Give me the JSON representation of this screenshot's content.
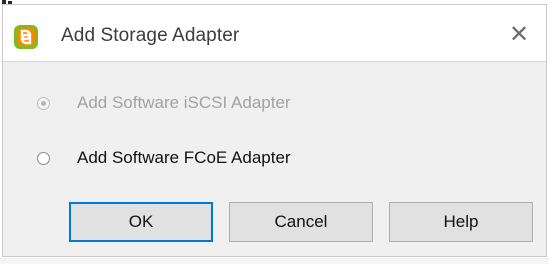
{
  "dialog": {
    "title": "Add Storage Adapter",
    "app_icon": "vsphere-logo-icon",
    "close_glyph": "✕"
  },
  "options": [
    {
      "label": "Add Software iSCSI Adapter",
      "selected": true,
      "enabled": false
    },
    {
      "label": "Add Software FCoE Adapter",
      "selected": false,
      "enabled": true
    }
  ],
  "buttons": {
    "ok": "OK",
    "cancel": "Cancel",
    "help": "Help"
  },
  "colors": {
    "accent": "#0078d7",
    "icon_green": "#78be20",
    "icon_orange": "#f38b00"
  }
}
